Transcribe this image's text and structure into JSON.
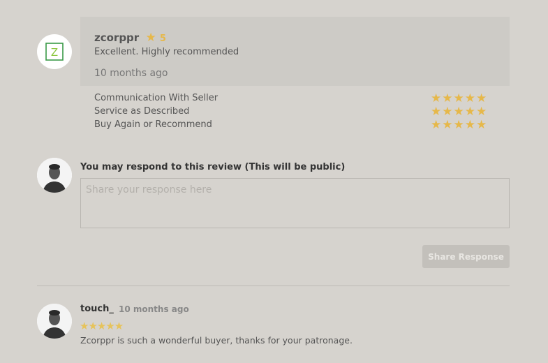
{
  "review": {
    "reviewer": "zcorppr",
    "rating": "5",
    "rating_star_icon": "star-icon",
    "text": "Excellent. Highly recommended",
    "time": "10 months ago",
    "avatar_letter": "Z"
  },
  "criteria": [
    {
      "label": "Communication With Seller",
      "stars": "★★★★★"
    },
    {
      "label": "Service as Described",
      "stars": "★★★★★"
    },
    {
      "label": "Buy Again or Recommend",
      "stars": "★★★★★"
    }
  ],
  "respond": {
    "label": "You may respond to this review (This will be public)",
    "placeholder": "Share your response here",
    "button_label": "Share Response"
  },
  "reply": {
    "name": "touch_",
    "time": "10 months ago",
    "stars": "★★★★★",
    "text": "Zcorppr is such a wonderful buyer, thanks for your patronage."
  },
  "colors": {
    "background": "#d6d3ce",
    "card": "#cdcbc6",
    "star": "#e6b84a",
    "button": "#c3c0bb"
  }
}
